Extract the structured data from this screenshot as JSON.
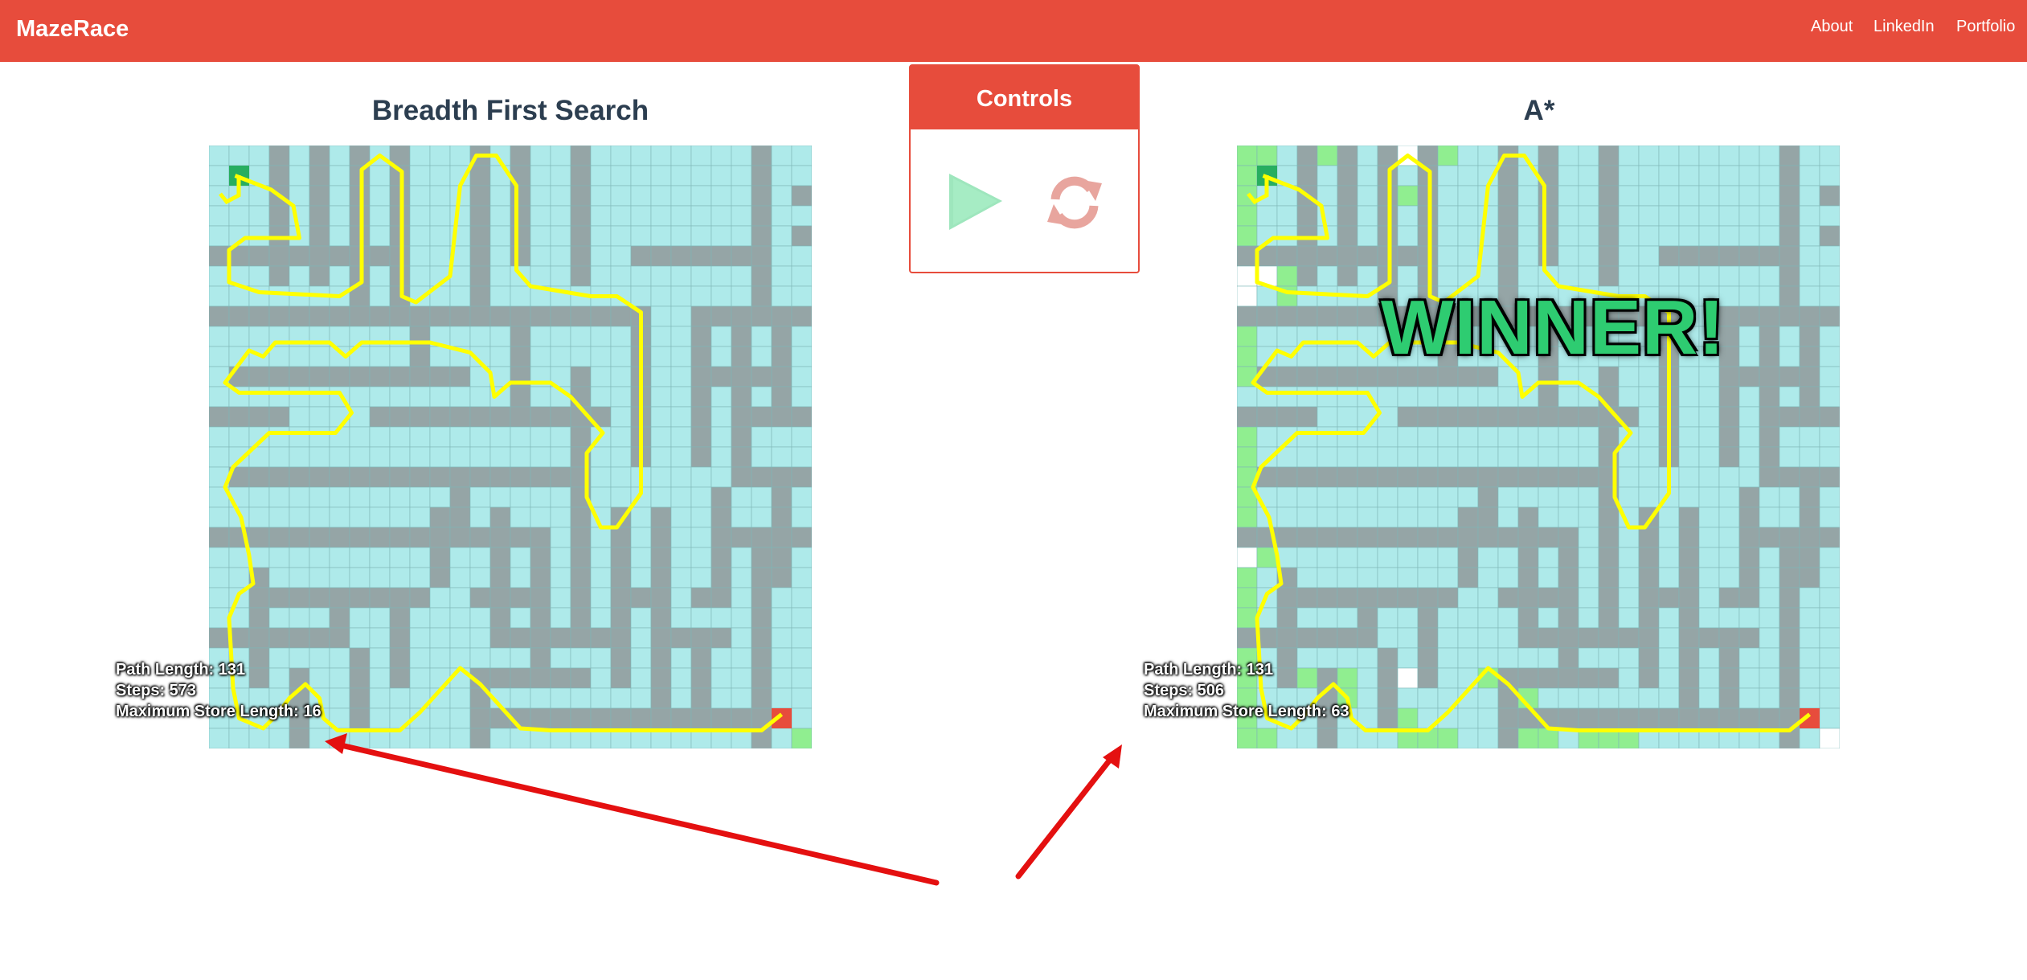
{
  "app": {
    "brand": "MazeRace"
  },
  "nav": {
    "links": [
      "About",
      "LinkedIn",
      "Portfolio"
    ]
  },
  "controls": {
    "title": "Controls",
    "play_icon": "play-icon",
    "reset_icon": "refresh-icon"
  },
  "left_panel": {
    "title": "Breadth First Search",
    "stats": {
      "path_length": "Path Length: 131",
      "steps": "Steps: 573",
      "max_store": "Maximum Store Length: 16"
    }
  },
  "right_panel": {
    "title": "A*",
    "stats": {
      "path_length": "Path Length: 131",
      "steps": "Steps: 506",
      "max_store": "Maximum Store Length: 63"
    },
    "banner": "WINNER!"
  },
  "colors": {
    "brand": "#e74c3c",
    "cell_open": "#aeeaea",
    "cell_wall": "#95a5a6",
    "cell_frontier": "#90ee90",
    "cell_unvisited": "#ffffff",
    "path": "#ffff00",
    "start": "#27ae60",
    "goal": "#e74c3c",
    "play": "#9ee6bd",
    "reset": "#e8a59e",
    "arrow": "#e41010"
  }
}
